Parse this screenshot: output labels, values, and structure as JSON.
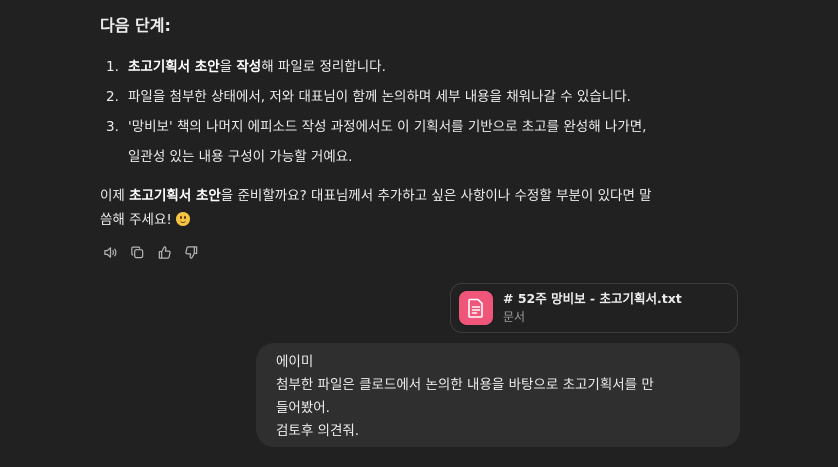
{
  "assistant": {
    "heading": "다음 단계:",
    "steps": [
      {
        "num": "1.",
        "bold1": "초고기획서 초안",
        "text1": "을 ",
        "bold2": "작성",
        "text2": "해 파일로 정리합니다."
      },
      {
        "num": "2.",
        "text": "파일을 첨부한 상태에서, 저와 대표님이 함께 논의하며 세부 내용을 채워나갈 수 있습니다."
      },
      {
        "num": "3.",
        "line1": "'망비보' 책의 나머지 에피소드 작성 과정에서도 이 기획서를 기반으로 초고를 완성해 나가면,",
        "line2": "일관성 있는 내용 구성이 가능할 거예요."
      }
    ],
    "closing": {
      "text1": "이제 ",
      "bold": "초고기획서 초안",
      "text2": "을 준비할까요? 대표님께서 추가하고 싶은 사항이나 수정할 부분이 있다면 말",
      "line2": "씀해 주세요!"
    },
    "emoji": "smiling-face-emoji",
    "actions": [
      "read-aloud-icon",
      "copy-icon",
      "thumbs-up-icon",
      "thumbs-down-icon"
    ]
  },
  "attachment": {
    "name": "# 52주 망비보 - 초고기획서.txt",
    "type": "문서",
    "icon_color": "#f0557a"
  },
  "user_message": {
    "lines": [
      "에이미",
      "첨부한 파일은 클로드에서 논의한 내용을 바탕으로 초고기획서를 만",
      "들어봤어.",
      "검토후 의견줘."
    ]
  },
  "colors": {
    "background": "#212121",
    "bubble": "#2f2f2f",
    "text": "#ececec"
  }
}
